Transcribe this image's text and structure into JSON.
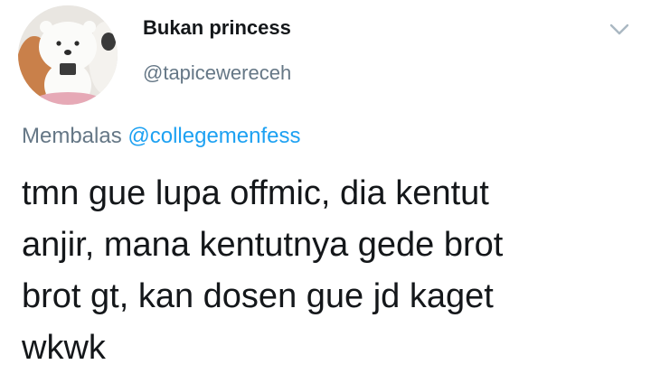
{
  "user": {
    "display_name": "Bukan princess",
    "handle": "@tapicewereceh",
    "avatar_icon": "cartoon-bear-avatar"
  },
  "menu": {
    "icon": "chevron-down-icon"
  },
  "reply": {
    "prefix": "Membalas",
    "mention": "@collegemenfess"
  },
  "tweet": {
    "lines": [
      "tmn gue lupa offmic, dia kentut",
      "anjir, mana kentutnya gede brot",
      "brot gt, kan dosen gue jd kaget",
      "wkwk"
    ]
  },
  "colors": {
    "text": "#14171a",
    "secondary": "#657786",
    "link": "#1da1f2"
  }
}
